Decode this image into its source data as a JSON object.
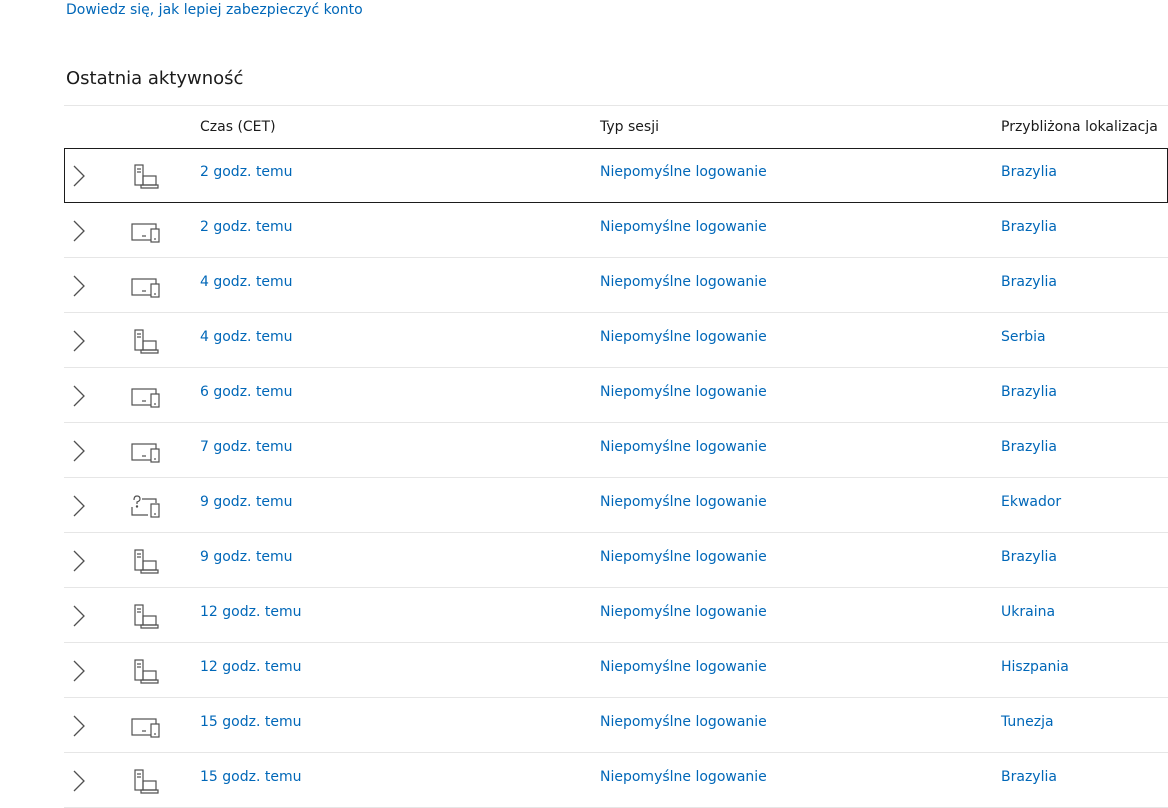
{
  "top_link": "Dowiedz się, jak lepiej zabezpieczyć konto",
  "section_title": "Ostatnia aktywność",
  "columns": {
    "time": "Czas (CET)",
    "type": "Typ sesji",
    "location": "Przybliżona lokalizacja"
  },
  "colors": {
    "link": "#0067b8",
    "text": "#1b1b1b",
    "divider": "#e6e6e6",
    "icon": "#505050"
  },
  "rows": [
    {
      "device_icon": "desktop-laptop-icon",
      "time": "2 godz. temu",
      "type": "Niepomyślne logowanie",
      "location": "Brazylia"
    },
    {
      "device_icon": "monitor-phone-icon",
      "time": "2 godz. temu",
      "type": "Niepomyślne logowanie",
      "location": "Brazylia"
    },
    {
      "device_icon": "monitor-phone-icon",
      "time": "4 godz. temu",
      "type": "Niepomyślne logowanie",
      "location": "Brazylia"
    },
    {
      "device_icon": "desktop-laptop-icon",
      "time": "4 godz. temu",
      "type": "Niepomyślne logowanie",
      "location": "Serbia"
    },
    {
      "device_icon": "monitor-phone-icon",
      "time": "6 godz. temu",
      "type": "Niepomyślne logowanie",
      "location": "Brazylia"
    },
    {
      "device_icon": "monitor-phone-icon",
      "time": "7 godz. temu",
      "type": "Niepomyślne logowanie",
      "location": "Brazylia"
    },
    {
      "device_icon": "unknown-device-icon",
      "time": "9 godz. temu",
      "type": "Niepomyślne logowanie",
      "location": "Ekwador"
    },
    {
      "device_icon": "desktop-laptop-icon",
      "time": "9 godz. temu",
      "type": "Niepomyślne logowanie",
      "location": "Brazylia"
    },
    {
      "device_icon": "desktop-laptop-icon",
      "time": "12 godz. temu",
      "type": "Niepomyślne logowanie",
      "location": "Ukraina"
    },
    {
      "device_icon": "desktop-laptop-icon",
      "time": "12 godz. temu",
      "type": "Niepomyślne logowanie",
      "location": "Hiszpania"
    },
    {
      "device_icon": "monitor-phone-icon",
      "time": "15 godz. temu",
      "type": "Niepomyślne logowanie",
      "location": "Tunezja"
    },
    {
      "device_icon": "desktop-laptop-icon",
      "time": "15 godz. temu",
      "type": "Niepomyślne logowanie",
      "location": "Brazylia"
    }
  ]
}
